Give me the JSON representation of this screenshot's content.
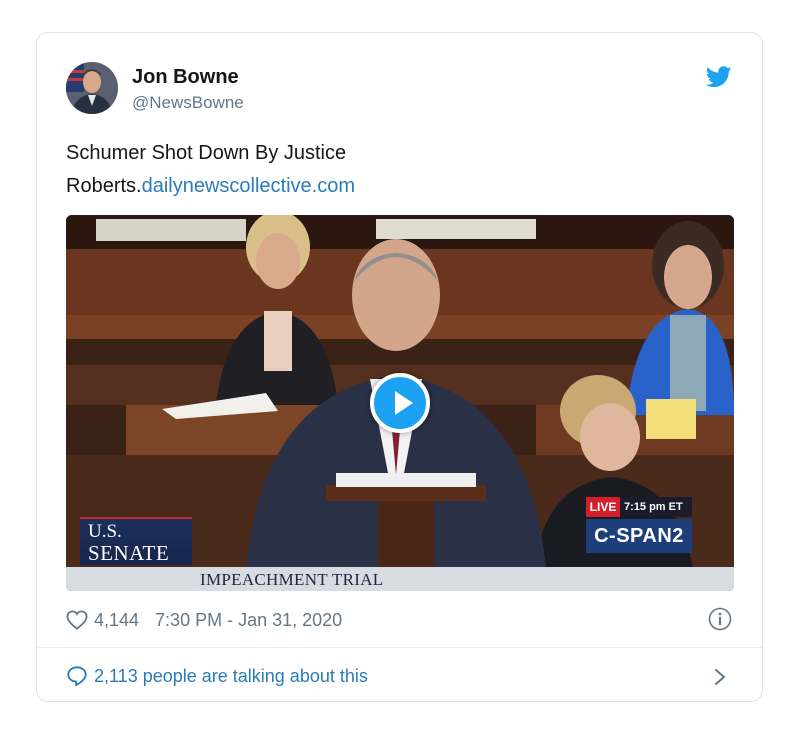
{
  "tweet": {
    "author_name": "Jon Bowne",
    "author_handle": "@NewsBowne",
    "text_line1": "Schumer Shot Down By Justice",
    "text_line2_prefix": "Roberts.",
    "text_link": "dailynewscollective.com",
    "like_count": "4,144",
    "timestamp": "7:30 PM - Jan 31, 2020",
    "talking_text": "2,113 people are talking about this"
  },
  "media": {
    "senate_logo_line1": "U.S.",
    "senate_logo_line2": "SENATE",
    "lower_third": "IMPEACHMENT TRIAL",
    "live_tag": "LIVE",
    "live_time": "7:15 pm ET",
    "network_logo": "C-SPAN2"
  },
  "icons": {
    "platform": "twitter-bird-icon",
    "like": "heart-icon",
    "info": "info-icon",
    "reply": "speech-bubble-icon",
    "more": "chevron-right-icon",
    "play": "play-icon"
  },
  "colors": {
    "brand_blue": "#1da1f2",
    "link_blue": "#2b7bb9",
    "text_dark": "#14171a",
    "text_gray": "#657786",
    "border": "#dfe3e6"
  }
}
